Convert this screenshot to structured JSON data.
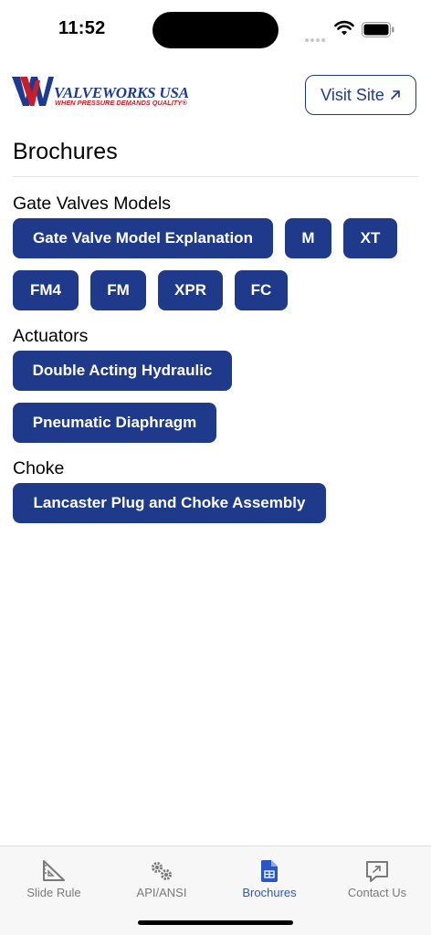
{
  "status": {
    "time": "11:52"
  },
  "header": {
    "logo_main": "VALVEWORKS USA",
    "logo_tagline": "WHEN PRESSURE DEMANDS QUALITY®",
    "visit_label": "Visit Site",
    "visit_icon": "arrow-up-right-icon"
  },
  "page": {
    "title": "Brochures"
  },
  "sections": {
    "gate": {
      "title": "Gate Valves Models",
      "items": [
        "Gate Valve Model Explanation",
        "M",
        "XT",
        "FM4",
        "FM",
        "XPR",
        "FC"
      ]
    },
    "actuators": {
      "title": "Actuators",
      "items": [
        "Double Acting Hydraulic",
        "Pneumatic Diaphragm"
      ]
    },
    "choke": {
      "title": "Choke",
      "items": [
        "Lancaster Plug and Choke Assembly"
      ]
    }
  },
  "colors": {
    "accent": "#1f3a8a",
    "active_tab": "#2a57c6",
    "logo_red": "#c81e2a"
  },
  "tabs": [
    {
      "label": "Slide Rule",
      "icon": "ruler-triangle-icon"
    },
    {
      "label": "API/ANSI",
      "icon": "gears-icon"
    },
    {
      "label": "Brochures",
      "icon": "document-icon",
      "active": true
    },
    {
      "label": "Contact Us",
      "icon": "message-icon"
    }
  ]
}
